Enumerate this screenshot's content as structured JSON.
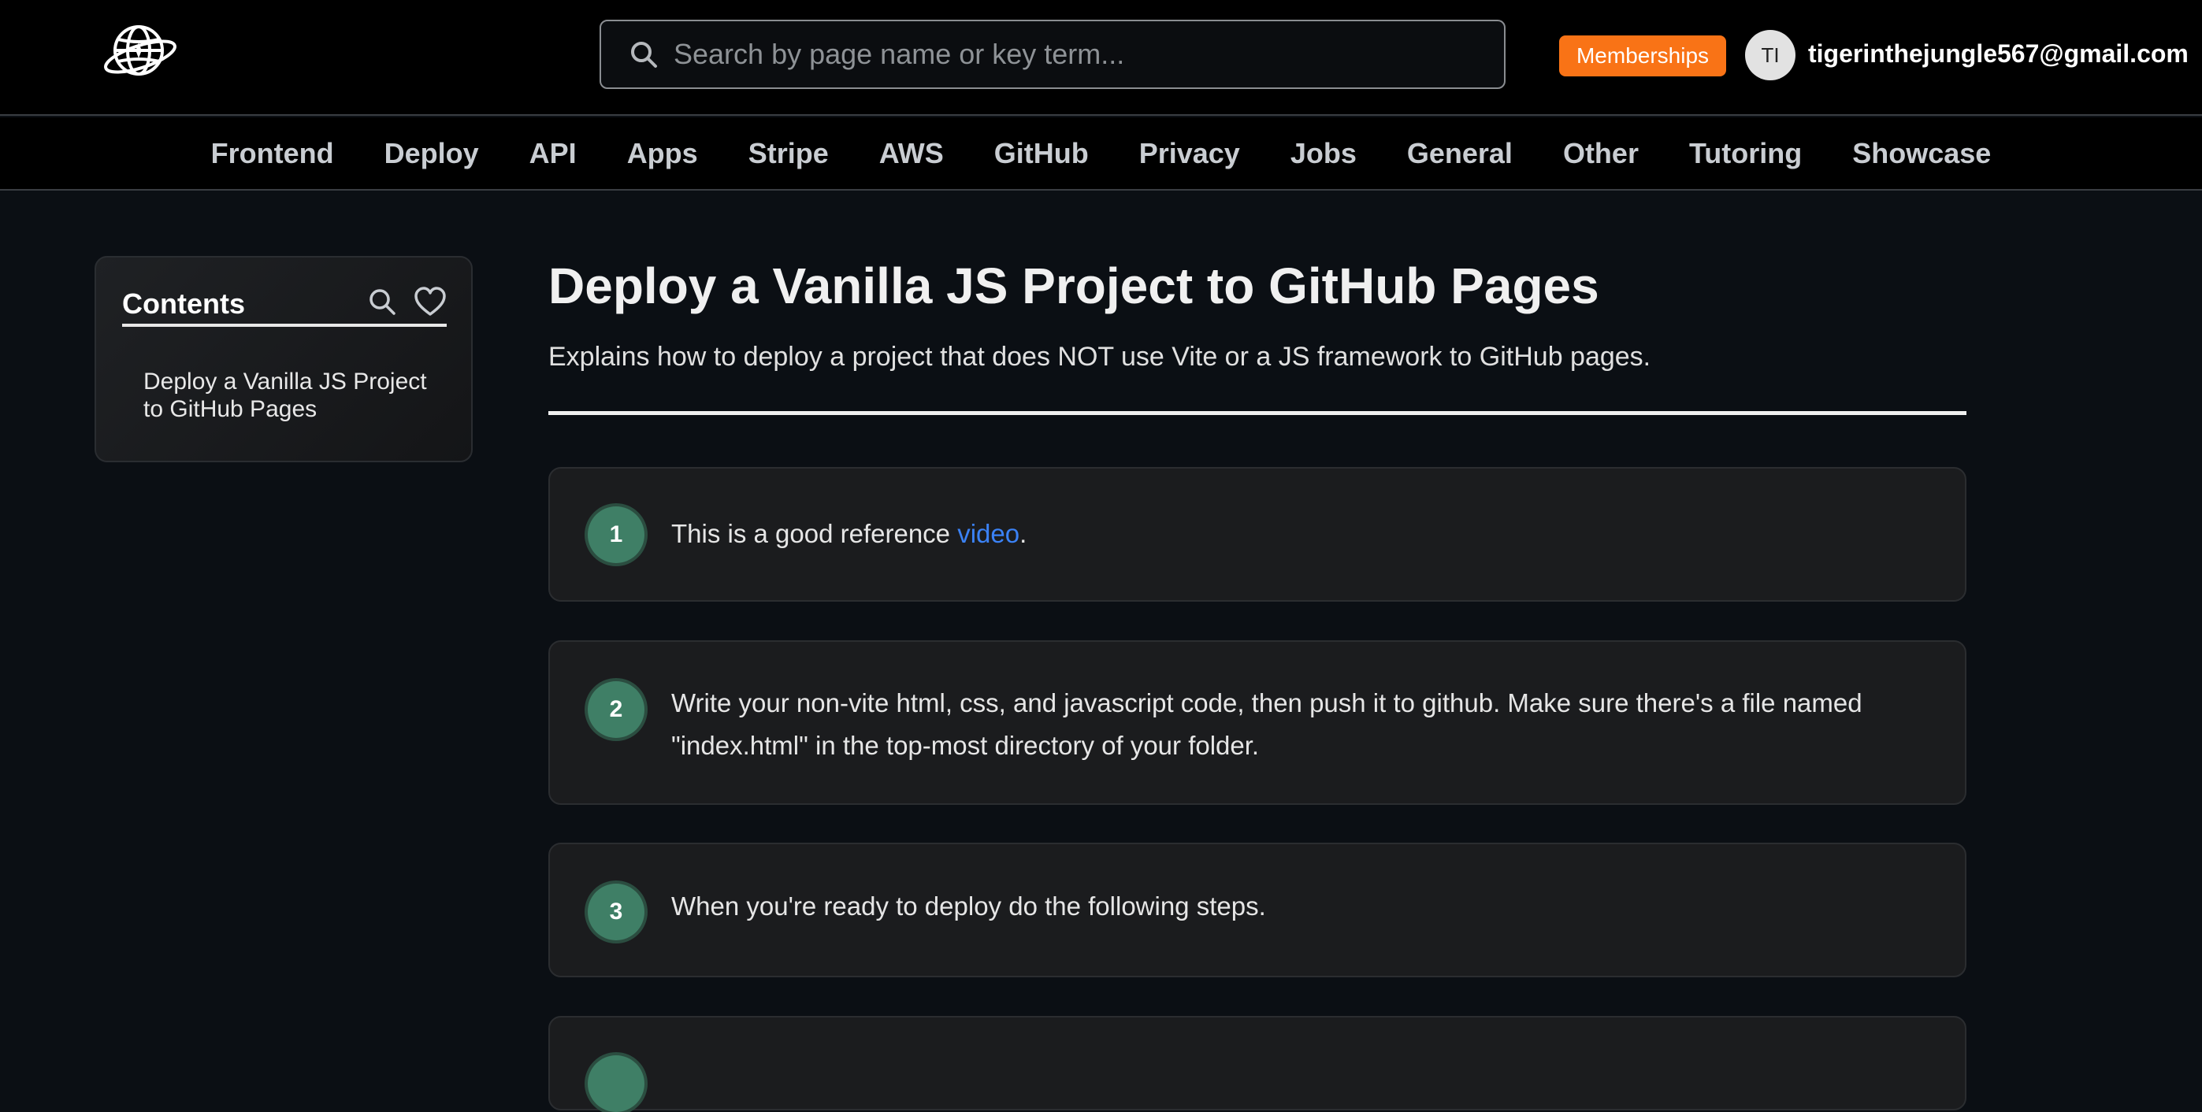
{
  "header": {
    "search": {
      "placeholder": "Search by page name or key term..."
    },
    "memberships_label": "Memberships",
    "avatar_initials": "TI",
    "user_email": "tigerinthejungle567@gmail.com"
  },
  "nav": {
    "items": [
      "Frontend",
      "Deploy",
      "API",
      "Apps",
      "Stripe",
      "AWS",
      "GitHub",
      "Privacy",
      "Jobs",
      "General",
      "Other",
      "Tutoring",
      "Showcase"
    ]
  },
  "toc": {
    "title": "Contents",
    "items": [
      "Deploy a Vanilla JS Project to GitHub Pages"
    ]
  },
  "article": {
    "title": "Deploy a Vanilla JS Project to GitHub Pages",
    "subtitle": "Explains how to deploy a project that does NOT use Vite or a JS framework to GitHub pages.",
    "steps": [
      {
        "number": "1",
        "text_before": "This is a good reference ",
        "link": "video",
        "text_after": "."
      },
      {
        "number": "2",
        "text": "Write your non-vite html, css, and javascript code, then push it to github. Make sure there's a file named \"index.html\" in the top-most directory of your folder."
      },
      {
        "number": "3",
        "text": "When you're ready to deploy do the following steps."
      }
    ]
  },
  "colors": {
    "accent": "#f97316",
    "step_badge": "#3f7f66",
    "link": "#3b82f6",
    "background": "#0b0f14"
  },
  "icons": [
    "globe-logo-icon",
    "search-icon",
    "heart-icon"
  ]
}
